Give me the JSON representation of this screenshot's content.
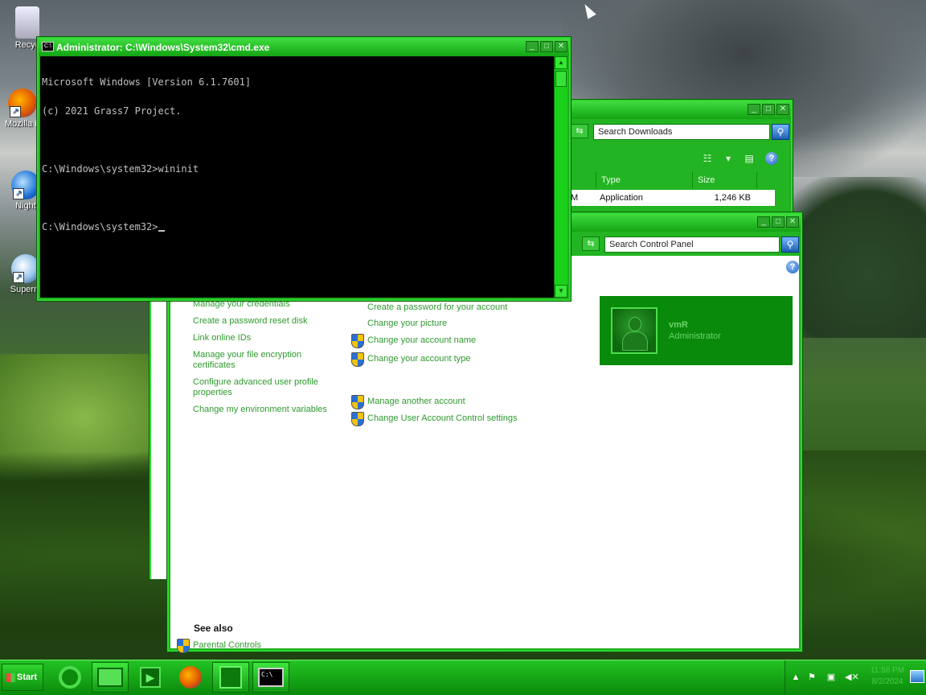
{
  "desktop": {
    "icons": [
      {
        "label": "Recyc"
      },
      {
        "label": "Mozilla F"
      },
      {
        "label": "Night"
      },
      {
        "label": "Superm"
      }
    ]
  },
  "cmd": {
    "title": "Administrator: C:\\Windows\\System32\\cmd.exe",
    "icon_text": "C:\\",
    "lines": [
      "Microsoft Windows [Version 6.1.7601]",
      "(c) 2021 Grass7 Project.",
      "",
      "C:\\Windows\\system32>wininit",
      "",
      "C:\\Windows\\system32>"
    ]
  },
  "downloads": {
    "search_placeholder": "Search Downloads",
    "columns": [
      "Type",
      "Size"
    ],
    "row": {
      "name_fragment": "M",
      "type": "Application",
      "size": "1,246 KB"
    }
  },
  "control_panel": {
    "search_placeholder": "Search Control Panel",
    "left_links": [
      "Manage your credentials",
      "Create a password reset disk",
      "Link online IDs",
      "Manage your file encryption certificates",
      "Configure advanced user profile properties",
      "Change my environment variables"
    ],
    "right_links": [
      "Create a password for your account",
      "Change your picture",
      "Change your account name",
      "Change your account type",
      "Manage another account",
      "Change User Account Control settings"
    ],
    "user": {
      "name": "vmR",
      "role": "Administrator"
    },
    "see_also_heading": "See also",
    "see_also_links": [
      "Parental Controls"
    ]
  },
  "taskbar": {
    "start_label": "Start",
    "clock_time": "11:56 PM",
    "clock_date": "8/2/2024"
  },
  "window_buttons": {
    "min": "_",
    "max": "□",
    "close": "✕"
  },
  "icons": {
    "search": "search-icon",
    "help": "help-icon",
    "shield": "uac-shield-icon",
    "nav_refresh": "refresh-icon"
  },
  "colors": {
    "accent": "#1fae1f",
    "link": "#2e9a2e",
    "console_bg": "#000000",
    "console_fg": "#c0c0c0"
  }
}
